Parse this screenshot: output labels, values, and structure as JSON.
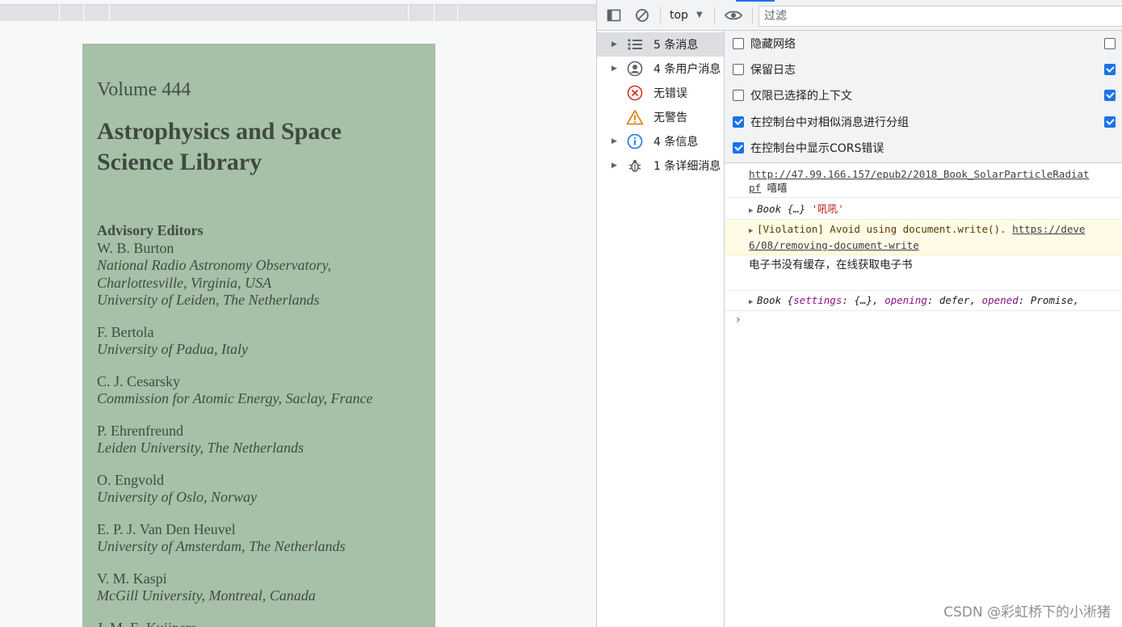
{
  "cover": {
    "volume": "Volume 444",
    "title_line1": "Astrophysics and Space",
    "title_line2": "Science Library",
    "advisory_heading": "Advisory Editors",
    "editors": [
      {
        "name": "W. B. Burton",
        "aff1": "National Radio Astronomy Observatory,",
        "aff2": "Charlottesville, Virginia, USA",
        "aff3": "University of Leiden, The Netherlands"
      },
      {
        "name": "F. Bertola",
        "aff1": "University of Padua, Italy"
      },
      {
        "name": "C. J. Cesarsky",
        "aff1": "Commission for Atomic Energy, Saclay, France"
      },
      {
        "name": "P. Ehrenfreund",
        "aff1": "Leiden University, The Netherlands"
      },
      {
        "name": "O. Engvold",
        "aff1": "University of Oslo, Norway"
      },
      {
        "name": "E. P. J. Van Den Heuvel",
        "aff1": "University of Amsterdam, The Netherlands"
      },
      {
        "name": "V. M. Kaspi",
        "aff1": "McGill University, Montreal, Canada"
      },
      {
        "name": "J. M. E. Kuijpers"
      }
    ]
  },
  "devtools": {
    "context": "top",
    "filter_placeholder": "过滤",
    "sidebar": [
      {
        "label": "5 条消息",
        "icon": "list-icon"
      },
      {
        "label": "4 条用户消息",
        "icon": "user-icon"
      },
      {
        "label": "无错误",
        "icon": "error-icon"
      },
      {
        "label": "无警告",
        "icon": "warning-icon"
      },
      {
        "label": "4 条信息",
        "icon": "info-icon"
      },
      {
        "label": "1 条详细消息",
        "icon": "bug-icon"
      }
    ],
    "settings": [
      {
        "label": "隐藏网络",
        "checked": false
      },
      {
        "label": "保留日志",
        "checked": false
      },
      {
        "label": "仅限已选择的上下文",
        "checked": false
      },
      {
        "label": "在控制台中对相似消息进行分组",
        "checked": true
      },
      {
        "label": "在控制台中显示CORS错误",
        "checked": true
      }
    ],
    "console": {
      "msg1_url": "http://47.99.166.157/epub2/2018_Book_SolarParticleRadiat",
      "msg1_url2": "pf",
      "msg1_text": "嘻嘻",
      "msg2_obj": "Book {…}",
      "msg2_str": "'吼吼'",
      "msg3_text": "[Violation] Avoid using document.write().",
      "msg3_link": "https://deve",
      "msg3_link2": "6/08/removing-document-write",
      "msg4_text": "电子书没有缓存，在线获取电子书",
      "msg5_obj": "Book {",
      "msg5_k1": "settings",
      "msg5_v1": "{…}",
      "msg5_k2": "opening",
      "msg5_v2": "defer",
      "msg5_k3": "opened",
      "msg5_v3": "Promise"
    }
  },
  "watermark": "CSDN @彩虹桥下的小淅猪"
}
